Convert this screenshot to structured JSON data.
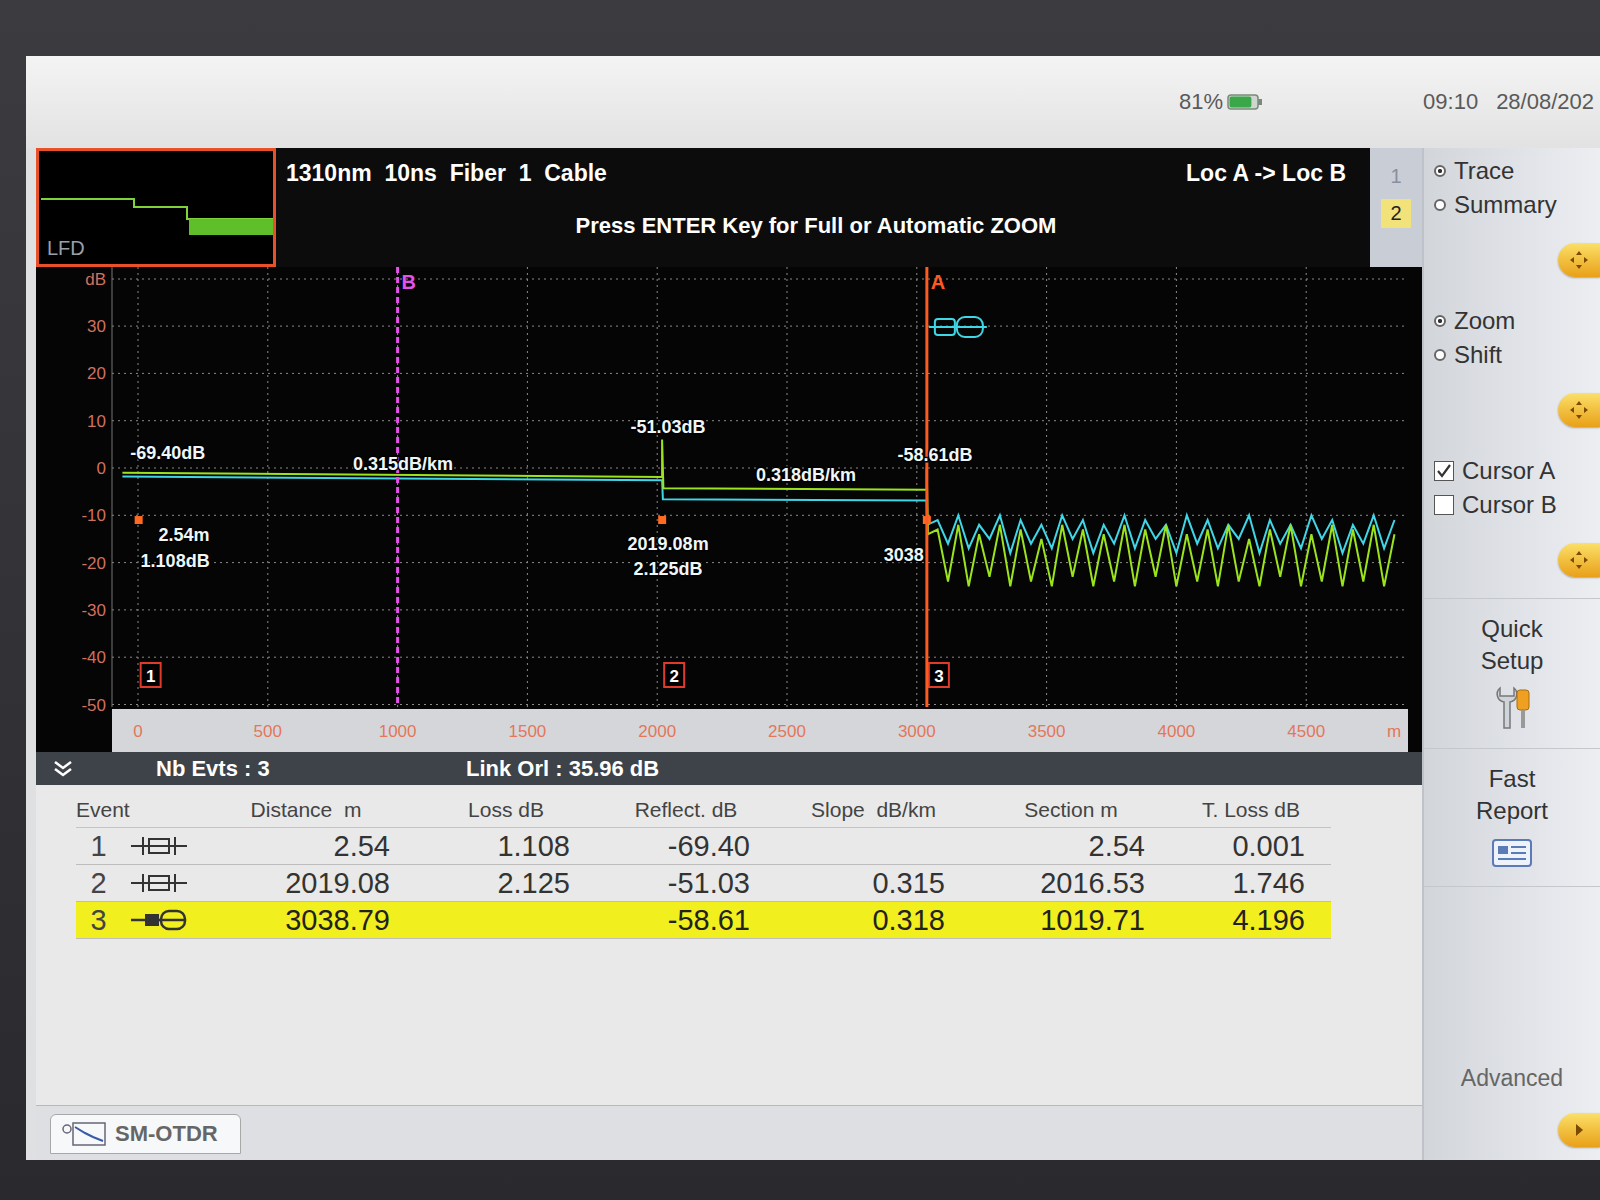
{
  "status_bar": {
    "battery": "81%",
    "battery_level": 0.81,
    "time": "09:10",
    "date": "28/08/202"
  },
  "header": {
    "thumbnail_label": "LFD",
    "title": "1310nm  10ns  Fiber  1  Cable",
    "direction": "Loc A -> Loc B",
    "hint": "Press ENTER Key for Full or Automatic ZOOM"
  },
  "pages": [
    {
      "label": "1",
      "selected": false
    },
    {
      "label": "2",
      "selected": true
    }
  ],
  "chart": {
    "y_unit": "dB",
    "y_ticks": [
      "30",
      "20",
      "10",
      "0",
      "-10",
      "-20",
      "-30",
      "-40",
      "-50"
    ],
    "x_unit": "m",
    "x_ticks": [
      "0",
      "500",
      "1000",
      "1500",
      "2000",
      "2500",
      "3000",
      "3500",
      "4000",
      "4500"
    ],
    "cursors": [
      {
        "label": "B",
        "distance": 1000,
        "color": "#e452e8",
        "dashed": true
      },
      {
        "label": "A",
        "distance": 3038.79,
        "color": "#ff5a22",
        "dashed": false
      }
    ],
    "series": [
      {
        "name": "reference",
        "color": "#3fd6e6",
        "distances": [
          -60,
          2019,
          2022,
          3038,
          3040,
          3080,
          3120,
          3160,
          3200,
          3240,
          3280,
          3320,
          3360,
          3400,
          3440,
          3480,
          3520,
          3560,
          3600,
          3640,
          3680,
          3720,
          3760,
          3800,
          3840,
          3880,
          3920,
          3960,
          4000,
          4040,
          4080,
          4120,
          4160,
          4200,
          4240,
          4280,
          4320,
          4360,
          4400,
          4440,
          4480,
          4520,
          4560,
          4600,
          4640,
          4680,
          4720,
          4760,
          4800,
          4840
        ],
        "values": [
          -1.8,
          -2.6,
          -6.6,
          -6.9,
          -12,
          -11,
          -16,
          -10,
          -17,
          -12,
          -15,
          -10,
          -18,
          -11,
          -16,
          -12,
          -17,
          -10,
          -15,
          -11,
          -18,
          -12,
          -16,
          -10,
          -17,
          -11,
          -15,
          -12,
          -18,
          -10,
          -16,
          -11,
          -17,
          -12,
          -15,
          -10,
          -18,
          -11,
          -16,
          -12,
          -17,
          -10,
          -15,
          -11,
          -18,
          -12,
          -16,
          -10,
          -17,
          -11
        ]
      },
      {
        "name": "current",
        "color": "#9be31c",
        "distances": [
          -60,
          2019,
          2019,
          2024,
          3038,
          3038,
          3043,
          3080,
          3120,
          3160,
          3200,
          3240,
          3280,
          3320,
          3360,
          3400,
          3440,
          3480,
          3520,
          3560,
          3600,
          3640,
          3680,
          3720,
          3760,
          3800,
          3840,
          3880,
          3920,
          3960,
          4000,
          4040,
          4080,
          4120,
          4160,
          4200,
          4240,
          4280,
          4320,
          4360,
          4400,
          4440,
          4480,
          4520,
          4560,
          4600,
          4640,
          4680,
          4720,
          4760,
          4800,
          4840
        ],
        "values": [
          -1.0,
          -1.9,
          6,
          -4.3,
          -4.6,
          0,
          -14,
          -13,
          -24,
          -12,
          -25,
          -14,
          -23,
          -12,
          -25,
          -13,
          -24,
          -15,
          -25,
          -12,
          -23,
          -13,
          -25,
          -14,
          -24,
          -12,
          -25,
          -13,
          -23,
          -12,
          -25,
          -14,
          -24,
          -13,
          -25,
          -12,
          -24,
          -15,
          -25,
          -13,
          -23,
          -12,
          -25,
          -14,
          -24,
          -12,
          -25,
          -13,
          -24,
          -12,
          -25,
          -14
        ]
      }
    ],
    "annotations": [
      {
        "text": "-69.40dB",
        "distance": 115,
        "value": 3.2
      },
      {
        "text": "0.315dB/km",
        "distance": 1021,
        "value": 0.8
      },
      {
        "text": "2.54m",
        "distance": 177,
        "value": -14.2
      },
      {
        "text": "1.108dB",
        "distance": 143,
        "value": -19.7
      },
      {
        "text": "-51.03dB",
        "distance": 2042,
        "value": 8.7
      },
      {
        "text": "0.318dB/km",
        "distance": 2573,
        "value": -1.5
      },
      {
        "text": "2019.08m",
        "distance": 2042,
        "value": -16.1
      },
      {
        "text": "2.125dB",
        "distance": 2042,
        "value": -21.4
      },
      {
        "text": "-58.61dB",
        "distance": 3070,
        "value": 2.7
      },
      {
        "text": "3038",
        "distance": 2950,
        "value": -18.4
      }
    ]
  },
  "summary_bar": {
    "events": "Nb Evts : 3",
    "link_orl": "Link Orl : 35.96 dB"
  },
  "table": {
    "columns": [
      "Event",
      "Distance  m",
      "Loss dB",
      "Reflect. dB",
      "Slope  dB/km",
      "Section m",
      "T. Loss dB"
    ],
    "rows": [
      {
        "event": "1",
        "kind": "connector",
        "distance": "2.54",
        "loss": "1.108",
        "reflect": "-69.40",
        "slope": "",
        "section": "2.54",
        "total_loss": "0.001",
        "selected": false
      },
      {
        "event": "2",
        "kind": "connector",
        "distance": "2019.08",
        "loss": "2.125",
        "reflect": "-51.03",
        "slope": "0.315",
        "section": "2016.53",
        "total_loss": "1.746",
        "selected": false
      },
      {
        "event": "3",
        "kind": "end",
        "distance": "3038.79",
        "loss": "",
        "reflect": "-58.61",
        "slope": "0.318",
        "section": "1019.71",
        "total_loss": "4.196",
        "selected": true
      }
    ]
  },
  "side_panel": {
    "view": [
      {
        "label": "Trace",
        "selected": true
      },
      {
        "label": "Summary",
        "selected": false
      }
    ],
    "mode": [
      {
        "label": "Zoom",
        "selected": true
      },
      {
        "label": "Shift",
        "selected": false
      }
    ],
    "cursors": [
      {
        "label": "Cursor A",
        "checked": true
      },
      {
        "label": "Cursor B",
        "checked": false
      }
    ],
    "actions": [
      "Quick Setup",
      "Fast Report"
    ],
    "advanced": "Advanced"
  },
  "bottom_tab": {
    "label": "SM-OTDR",
    "selected": true
  }
}
